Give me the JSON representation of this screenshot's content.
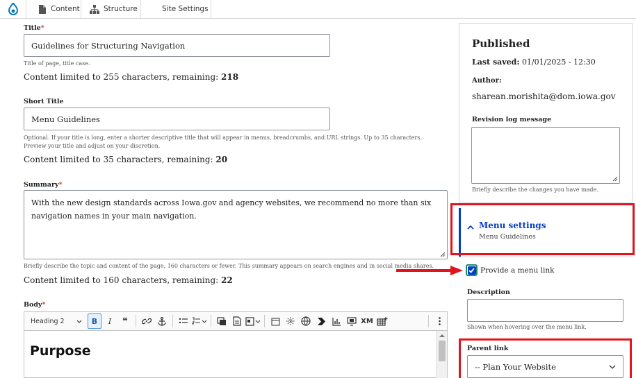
{
  "toolbar": {
    "items": [
      {
        "label": "Content",
        "icon": "file-icon"
      },
      {
        "label": "Structure",
        "icon": "sitemap-icon"
      },
      {
        "label": "Site Settings",
        "icon": ""
      }
    ]
  },
  "form": {
    "title": {
      "label": "Title",
      "value": "Guidelines for Structuring Navigation",
      "help": "Title of page, title case.",
      "limit_text": "Content limited to 255 characters, remaining: ",
      "remaining": "218"
    },
    "short_title": {
      "label": "Short Title",
      "value": "Menu Guidelines",
      "help": "Optional. If your title is long, enter a shorter descriptive title that will appear in menus, breadcrumbs, and URL strings. Up to 35 characters. Preview your title and adjust on your discretion.",
      "limit_text": "Content limited to 35 characters, remaining: ",
      "remaining": "20"
    },
    "summary": {
      "label": "Summary",
      "value": "With the new design standards across Iowa.gov and agency websites, we recommend no more than six navigation names in your main navigation.",
      "help": "Briefly describe the topic and content of the page, 160 characters or fewer. This summary appears on search engines and in social media shares.",
      "limit_text": "Content limited to 160 characters, remaining: ",
      "remaining": "22"
    },
    "body": {
      "label": "Body",
      "heading_select": "Heading 2",
      "content_heading": "Purpose"
    }
  },
  "sidebar": {
    "status": "Published",
    "last_saved_label": "Last saved:",
    "last_saved_value": "01/01/2025 - 12:30",
    "author_label": "Author:",
    "author_value": "sharean.morishita@dom.iowa.gov",
    "revision_label": "Revision log message",
    "revision_help": "Briefly describe the changes you have made."
  },
  "menu_settings": {
    "title": "Menu settings",
    "subtitle": "Menu Guidelines",
    "provide_link_label": "Provide a menu link",
    "provide_link_checked": true,
    "description_label": "Description",
    "description_help": "Shown when hovering over the menu link.",
    "parent_link_label": "Parent link",
    "parent_link_value": "-- Plan Your Website"
  },
  "colors": {
    "accent": "#003ecc",
    "highlight": "#e1141d",
    "required": "#c0392b"
  }
}
